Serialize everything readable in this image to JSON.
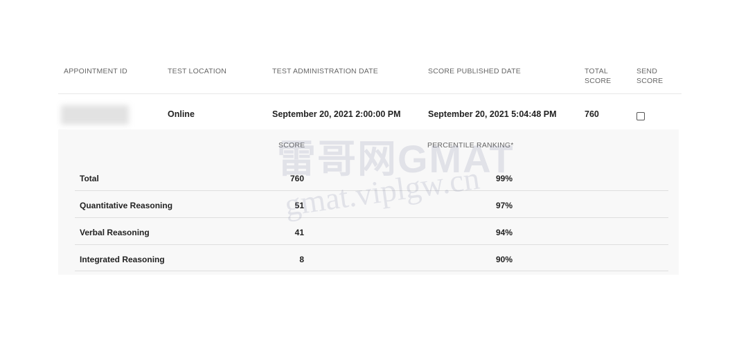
{
  "table": {
    "headers": [
      "APPOINTMENT ID",
      "TEST LOCATION",
      "TEST ADMINISTRATION DATE",
      "SCORE PUBLISHED DATE",
      "TOTAL SCORE",
      "SEND SCORE"
    ],
    "row": {
      "appointment_id": "",
      "test_location": "Online",
      "test_administration_date": "September 20, 2021 2:00:00 PM",
      "score_published_date": "September 20, 2021 5:04:48 PM",
      "total_score": "760",
      "send_score_checked": false
    }
  },
  "details": {
    "score_header": "SCORE",
    "percentile_header": "PERCENTILE RANKING*",
    "rows": [
      {
        "label": "Total",
        "score": "760",
        "percentile": "99%"
      },
      {
        "label": "Quantitative Reasoning",
        "score": "51",
        "percentile": "97%"
      },
      {
        "label": "Verbal Reasoning",
        "score": "41",
        "percentile": "94%"
      },
      {
        "label": "Integrated Reasoning",
        "score": "8",
        "percentile": "90%"
      }
    ]
  },
  "watermark": {
    "line1": "雷哥网GMAT",
    "line2": "gmat.viplgw.cn"
  }
}
